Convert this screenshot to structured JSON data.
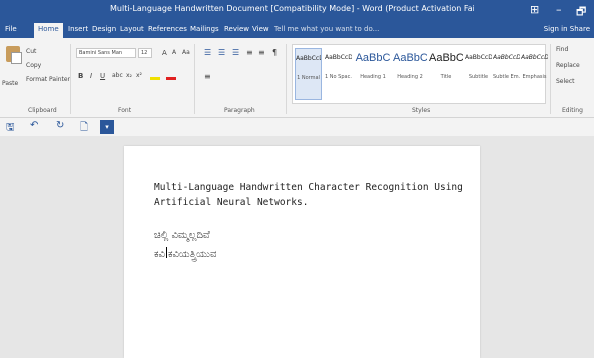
{
  "window": {
    "title": "Multi-Language Handwritten Document [Compatibility Mode] - Word (Product Activation Failed)",
    "controls": [
      "⊞",
      "–",
      "🗗"
    ]
  },
  "tabs": [
    "File",
    "Home",
    "Insert",
    "Design",
    "Layout",
    "References",
    "Mailings",
    "Review",
    "View"
  ],
  "active_tab": "Home",
  "tell_me": "Tell me what you want to do...",
  "sign_in": "Sign in",
  "share": "Share",
  "clipboard": {
    "paste": "Paste",
    "cut": "Cut",
    "copy": "Copy",
    "format_painter": "Format Painter",
    "label": "Clipboard"
  },
  "font": {
    "name": "Bamini Sans Man",
    "size": "12",
    "label": "Font",
    "buttons": [
      "B",
      "I",
      "U",
      "abc",
      "x₂",
      "x²",
      "A",
      "A",
      "Aa"
    ]
  },
  "paragraph": {
    "label": "Paragraph",
    "buttons": [
      "☰",
      "☰",
      "☰",
      "≡",
      "≡",
      "≡",
      "¶"
    ]
  },
  "styles": {
    "label": "Styles",
    "items": [
      {
        "preview": "AaBbCcDc",
        "name": "1 Normal",
        "big": false
      },
      {
        "preview": "AaBbCcDc",
        "name": "1 No Spac...",
        "big": false
      },
      {
        "preview": "AaBbC",
        "name": "Heading 1",
        "big": true
      },
      {
        "preview": "AaBbC",
        "name": "Heading 2",
        "big": true
      },
      {
        "preview": "AaBbC",
        "name": "Title",
        "big": true
      },
      {
        "preview": "AaBbCcD",
        "name": "Subtitle",
        "big": false
      },
      {
        "preview": "AaBbCcDi",
        "name": "Subtle Em...",
        "big": false
      },
      {
        "preview": "AaBbCcDi",
        "name": "Emphasis",
        "big": false
      }
    ]
  },
  "editing": {
    "find": "Find",
    "replace": "Replace",
    "select": "Select",
    "label": "Editing"
  },
  "document": {
    "line1": "Multi-Language Handwritten Character Recognition Using",
    "line2": "Artificial Neural Networks.",
    "kannada1": "ಚಿಲ್ಲಿ ವಿಮ್ಮಲ್ಲದಿವೆ",
    "kannada2a": "ಕವಿ",
    "kannada2b": "ಕವಿಯತ್ತ್ರಿಯುವ"
  }
}
